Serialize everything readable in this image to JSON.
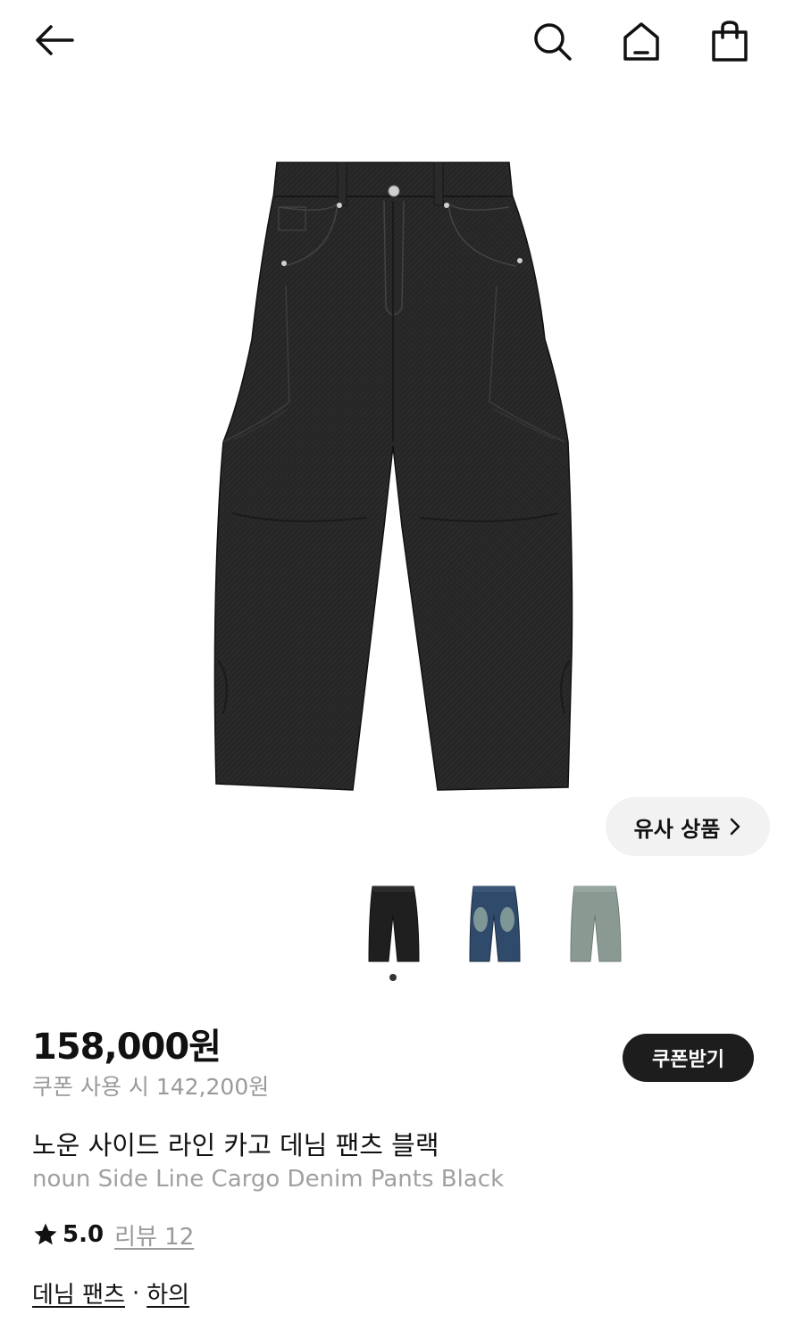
{
  "icons": {
    "back": "back-arrow-icon",
    "search": "search-icon",
    "home": "home-icon",
    "bag": "shopping-bag-icon",
    "chevron": "chevron-right-icon",
    "star": "star-icon"
  },
  "colors": {
    "denim_black": "#262626",
    "denim_blue": "#2f4a6b",
    "denim_sage": "#8a9a92",
    "dark_button": "#1d1d1d"
  },
  "similar_button": {
    "label": "유사 상품"
  },
  "product": {
    "price": "158,000원",
    "coupon_price": "쿠폰 사용 시 142,200원",
    "coupon_button": "쿠폰받기",
    "name_ko": "노운 사이드 라인 카고 데님 팬츠 블랙",
    "name_en": "noun Side Line Cargo Denim Pants Black",
    "rating": "5.0",
    "review_label": "리뷰 12"
  },
  "categories": {
    "primary": "데님 팬츠",
    "separator": "·",
    "secondary": "하의"
  },
  "gallery": {
    "active_index": 0,
    "count": 3
  }
}
